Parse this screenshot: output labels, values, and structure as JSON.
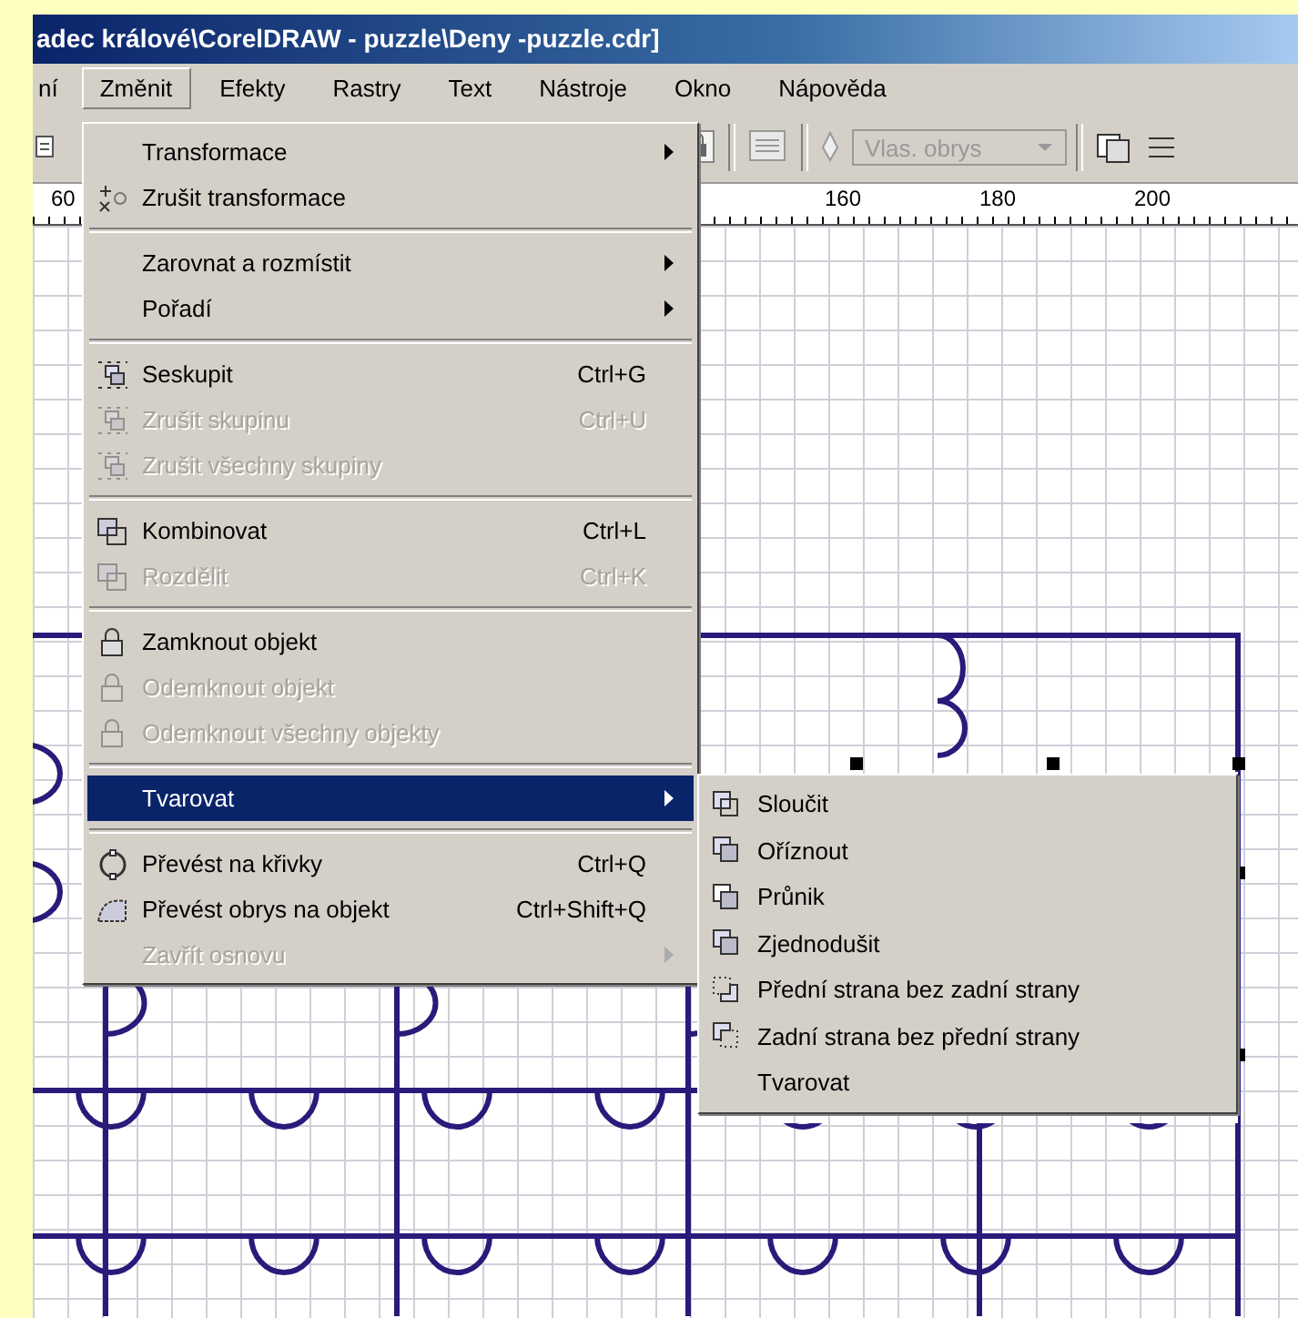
{
  "window": {
    "title": "adec králové\\CorelDRAW - puzzle\\Deny -puzzle.cdr]"
  },
  "menubar": [
    {
      "label": "ní",
      "selected": false
    },
    {
      "label": "Změnit",
      "selected": true
    },
    {
      "label": "Efekty",
      "selected": false
    },
    {
      "label": "Rastry",
      "selected": false
    },
    {
      "label": "Text",
      "selected": false
    },
    {
      "label": "Nástroje",
      "selected": false
    },
    {
      "label": "Okno",
      "selected": false
    },
    {
      "label": "Nápověda",
      "selected": false
    }
  ],
  "toolbar": {
    "outline_dropdown": {
      "value": "Vlas. obrys",
      "disabled": true
    }
  },
  "ruler": {
    "labels": [
      "60",
      "160",
      "180",
      "200"
    ]
  },
  "menu": [
    {
      "kind": "item",
      "label": "Transformace",
      "disabled": false,
      "submenu": true,
      "selected": false
    },
    {
      "kind": "item",
      "label": "Zrušit transformace",
      "disabled": false,
      "submenu": false,
      "selected": false
    },
    {
      "kind": "separator"
    },
    {
      "kind": "item",
      "label": "Zarovnat a rozmístit",
      "disabled": false,
      "submenu": true,
      "selected": false
    },
    {
      "kind": "item",
      "label": "Pořadí",
      "disabled": false,
      "submenu": true,
      "selected": false
    },
    {
      "kind": "separator"
    },
    {
      "kind": "item",
      "label": "Seskupit",
      "shortcut": "Ctrl+G",
      "disabled": false,
      "submenu": false,
      "selected": false
    },
    {
      "kind": "item",
      "label": "Zrušit skupinu",
      "shortcut": "Ctrl+U",
      "disabled": true,
      "submenu": false,
      "selected": false
    },
    {
      "kind": "item",
      "label": "Zrušit všechny skupiny",
      "disabled": true,
      "submenu": false,
      "selected": false
    },
    {
      "kind": "separator"
    },
    {
      "kind": "item",
      "label": "Kombinovat",
      "shortcut": "Ctrl+L",
      "disabled": false,
      "submenu": false,
      "selected": false
    },
    {
      "kind": "item",
      "label": "Rozdělit",
      "shortcut": "Ctrl+K",
      "disabled": true,
      "submenu": false,
      "selected": false
    },
    {
      "kind": "separator"
    },
    {
      "kind": "item",
      "label": "Zamknout objekt",
      "disabled": false,
      "submenu": false,
      "selected": false
    },
    {
      "kind": "item",
      "label": "Odemknout objekt",
      "disabled": true,
      "submenu": false,
      "selected": false
    },
    {
      "kind": "item",
      "label": "Odemknout všechny objekty",
      "disabled": true,
      "submenu": false,
      "selected": false
    },
    {
      "kind": "separator"
    },
    {
      "kind": "item",
      "label": "Tvarovat",
      "disabled": false,
      "submenu": true,
      "selected": true
    },
    {
      "kind": "separator"
    },
    {
      "kind": "item",
      "label": "Převést na křivky",
      "shortcut": "Ctrl+Q",
      "disabled": false,
      "submenu": false,
      "selected": false
    },
    {
      "kind": "item",
      "label": "Převést obrys na objekt",
      "shortcut": "Ctrl+Shift+Q",
      "disabled": false,
      "submenu": false,
      "selected": false
    },
    {
      "kind": "item",
      "label": "Zavřít osnovu",
      "disabled": true,
      "submenu": true,
      "selected": false
    }
  ],
  "submenu": [
    {
      "label": "Sloučit"
    },
    {
      "label": "Oříznout"
    },
    {
      "label": "Průnik"
    },
    {
      "label": "Zjednodušit"
    },
    {
      "label": "Přední strana bez zadní strany"
    },
    {
      "label": "Zadní strana bez přední strany"
    },
    {
      "label": "Tvarovat"
    }
  ]
}
